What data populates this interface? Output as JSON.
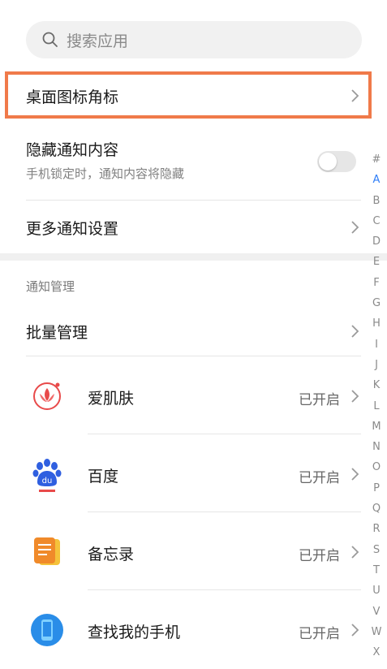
{
  "search": {
    "placeholder": "搜索应用",
    "icon": "search-icon"
  },
  "settings": {
    "desktop_badge": {
      "label": "桌面图标角标"
    },
    "hide_content": {
      "label": "隐藏通知内容",
      "subtitle": "手机锁定时，通知内容将隐藏",
      "enabled": false
    },
    "more_settings": {
      "label": "更多通知设置"
    }
  },
  "section": {
    "header": "通知管理"
  },
  "batch": {
    "label": "批量管理"
  },
  "apps": [
    {
      "name": "爱肌肤",
      "status": "已开启",
      "icon": "lotus-app-icon"
    },
    {
      "name": "百度",
      "status": "已开启",
      "icon": "baidu-paw-icon"
    },
    {
      "name": "备忘录",
      "status": "已开启",
      "icon": "notes-app-icon"
    },
    {
      "name": "查找我的手机",
      "status": "已开启",
      "icon": "find-phone-icon"
    }
  ],
  "alphabet": [
    "#",
    "A",
    "B",
    "C",
    "D",
    "E",
    "F",
    "G",
    "H",
    "I",
    "J",
    "K",
    "L",
    "M",
    "N",
    "O",
    "P",
    "Q",
    "R",
    "S",
    "T",
    "U",
    "V",
    "W",
    "X"
  ],
  "alphabet_active": "A",
  "colors": {
    "highlight": "#f07a4a",
    "accent": "#2f7ef7"
  }
}
